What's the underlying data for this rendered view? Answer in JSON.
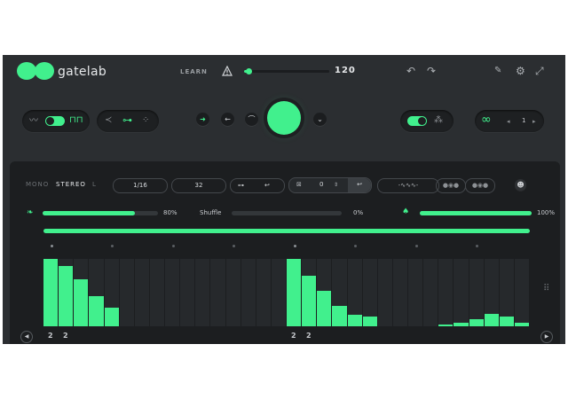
{
  "app": {
    "title": "gatelab"
  },
  "header": {
    "learn_label": "LEARN",
    "tempo": {
      "value": "120",
      "fraction": 0.05
    },
    "undo_icon": "undo-icon",
    "redo_icon": "redo-icon",
    "pen_icon": "pen-icon",
    "settings_icon": "gear-icon",
    "expand_icon": "expand-icon"
  },
  "controls": {
    "wave_toggle_on": true,
    "loop_stepper_value": "1",
    "envelope_toggle_on": true
  },
  "sequencer": {
    "modes": [
      "MONO",
      "STEREO",
      "L"
    ],
    "active_mode": "STEREO",
    "rate": "1/16",
    "steps": "32",
    "offset": "0",
    "mix": {
      "percent": 80,
      "label": "80%"
    },
    "shuffle": {
      "label": "Shuffle",
      "percent": 0,
      "value_label": "0%"
    },
    "output": {
      "percent": 100,
      "label": "100%"
    },
    "step_values": [
      1.0,
      0.9,
      0.7,
      0.45,
      0.27,
      0,
      0,
      0,
      0,
      0,
      0,
      0,
      0,
      0,
      0,
      0,
      1.0,
      0.75,
      0.52,
      0.3,
      0.17,
      0.15,
      0,
      0,
      0,
      0,
      0.03,
      0.05,
      0.1,
      0.18,
      0.15,
      0.05
    ],
    "step_labels": [
      "2",
      "2"
    ],
    "accent_steps": [
      0,
      4,
      8,
      12,
      16,
      20,
      24,
      28
    ]
  },
  "colors": {
    "accent": "#41f08d",
    "background": "#2b2e31",
    "panel": "#1c1e20"
  }
}
